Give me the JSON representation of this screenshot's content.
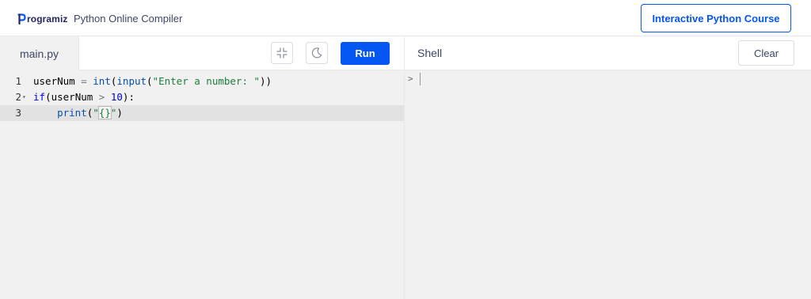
{
  "header": {
    "logo_text": "rogramiz",
    "app_title": "Python Online Compiler",
    "course_button": "Interactive Python Course"
  },
  "editor": {
    "file_tab": "main.py",
    "run_label": "Run",
    "fullscreen_icon": "collapse-icon",
    "theme_icon": "moon-icon",
    "lines": [
      {
        "num": "1",
        "code": "userNum = int(input(\"Enter a number: \"))"
      },
      {
        "num": "2",
        "code": "if(userNum > 10):"
      },
      {
        "num": "3",
        "code": "    print(\"{}\")"
      }
    ],
    "active_line": 3
  },
  "shell": {
    "title": "Shell",
    "clear_label": "Clear",
    "prompt": ">"
  },
  "colors": {
    "accent": "#0556f3",
    "keyword": "#0000ff",
    "string": "#1a7f37",
    "number": "#0000cd",
    "editor_background": "#f1f1f1"
  }
}
